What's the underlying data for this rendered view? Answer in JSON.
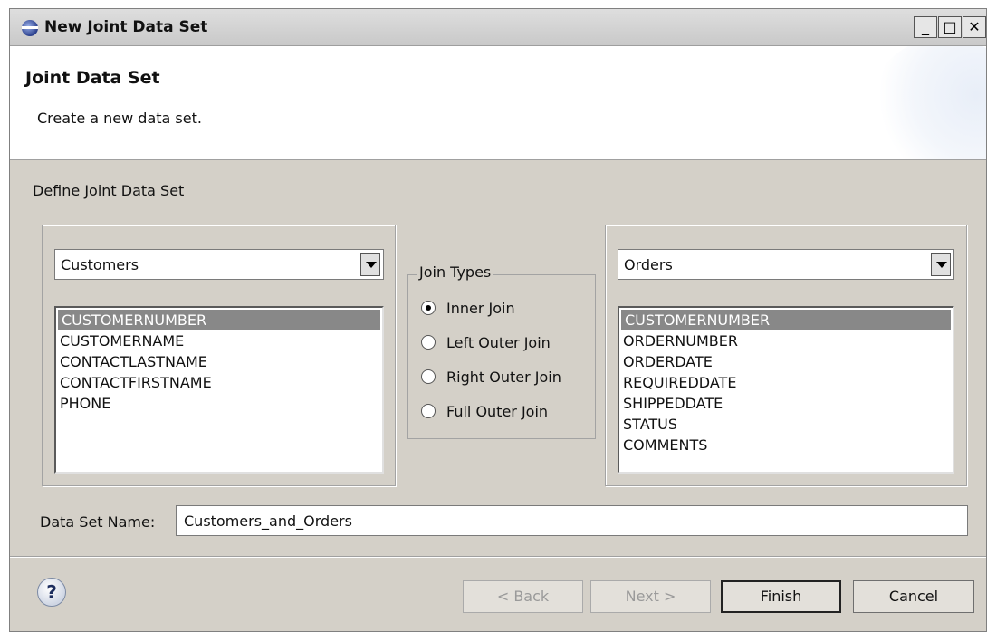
{
  "window": {
    "title": "New Joint Data Set"
  },
  "header": {
    "title": "Joint Data Set",
    "description": "Create a new data set."
  },
  "section_label": "Define Joint Data Set",
  "left": {
    "dataset": "Customers",
    "columns": [
      "CUSTOMERNUMBER",
      "CUSTOMERNAME",
      "CONTACTLASTNAME",
      "CONTACTFIRSTNAME",
      "PHONE"
    ],
    "selected_index": 0
  },
  "join_types": {
    "label": "Join Types",
    "options": [
      "Inner Join",
      "Left Outer Join",
      "Right Outer Join",
      "Full Outer Join"
    ],
    "selected": "Inner Join"
  },
  "right": {
    "dataset": "Orders",
    "columns": [
      "CUSTOMERNUMBER",
      "ORDERNUMBER",
      "ORDERDATE",
      "REQUIREDDATE",
      "SHIPPEDDATE",
      "STATUS",
      "COMMENTS"
    ],
    "selected_index": 0
  },
  "dataset_name": {
    "label": "Data Set Name:",
    "value": "Customers_and_Orders"
  },
  "buttons": {
    "back": "< Back",
    "next": "Next >",
    "finish": "Finish",
    "cancel": "Cancel",
    "help": "?"
  },
  "icons": {
    "app": "eclipse-icon",
    "help": "help-icon"
  }
}
